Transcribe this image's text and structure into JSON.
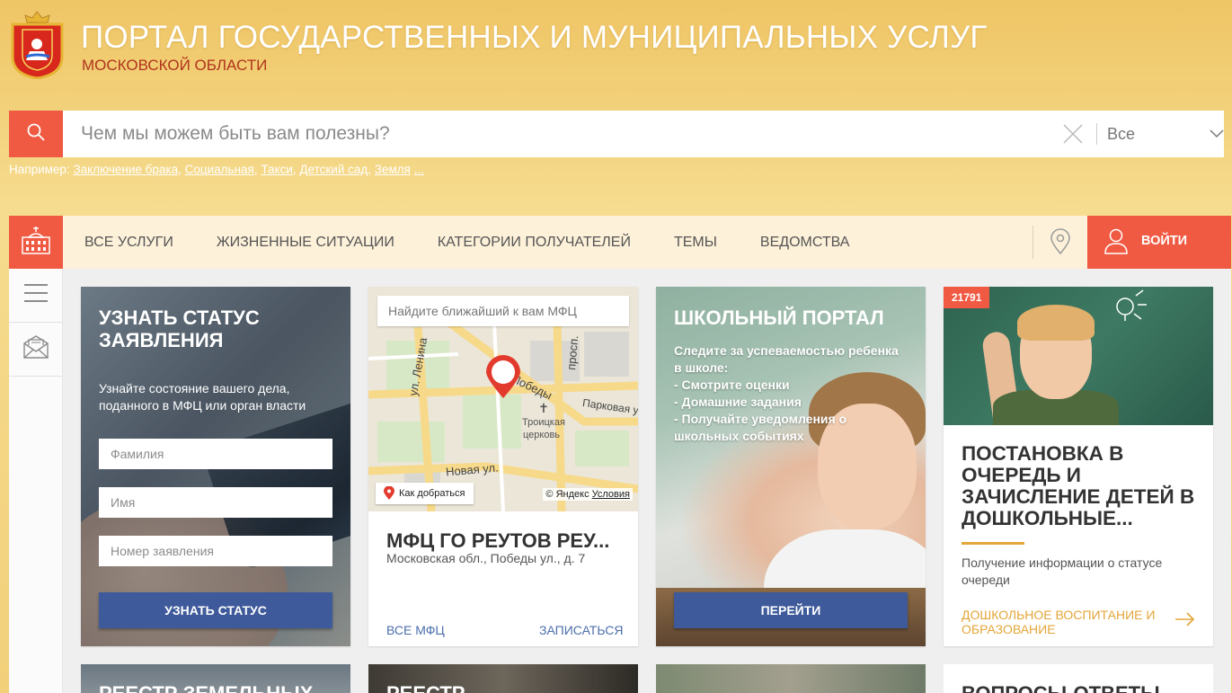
{
  "header": {
    "title": "ПОРТАЛ ГОСУДАРСТВЕННЫХ И МУНИЦИПАЛЬНЫХ УСЛУГ",
    "subtitle": "МОСКОВСКОЙ ОБЛАСТИ"
  },
  "search": {
    "placeholder": "Чем мы можем быть вам полезны?",
    "scope": "Все",
    "examples_label": "Например:",
    "examples": [
      "Заключение брака",
      "Социальная",
      "Такси",
      "Детский сад",
      "Земля"
    ],
    "examples_more": "..."
  },
  "nav": {
    "items": [
      "ВСЕ УСЛУГИ",
      "ЖИЗНЕННЫЕ СИТУАЦИИ",
      "КАТЕГОРИИ ПОЛУЧАТЕЛЕЙ",
      "ТЕМЫ",
      "ВЕДОМСТВА"
    ],
    "login": "ВОЙТИ"
  },
  "cards": {
    "status": {
      "title": "УЗНАТЬ СТАТУС ЗАЯВЛЕНИЯ",
      "desc": "Узнайте состояние вашего дела, поданного в МФЦ или орган власти",
      "fields": [
        "Фамилия",
        "Имя",
        "Номер заявления"
      ],
      "button": "УЗНАТЬ СТАТУС"
    },
    "mfc": {
      "search_placeholder": "Найдите ближайший к вам МФЦ",
      "route": "Как добраться",
      "copyright": "© Яндекс",
      "terms": "Условия",
      "streets": [
        "ул. Ленина",
        "просп.",
        "Победы",
        "Парковая ул.",
        "Новая ул.",
        "Троицкая",
        "церковь"
      ],
      "name": "МФЦ ГО РЕУТОВ РЕУ...",
      "address": "Московская обл., Победы ул., д. 7",
      "all": "ВСЕ МФЦ",
      "signup": "ЗАПИСАТЬСЯ"
    },
    "school": {
      "title": "ШКОЛЬНЫЙ ПОРТАЛ",
      "desc": "Следите за успеваемостью ребенка в школе:\n- Смотрите оценки\n- Домашние задания\n- Получайте уведомления о школьных событиях",
      "button": "ПЕРЕЙТИ"
    },
    "queue": {
      "badge": "21791",
      "title": "ПОСТАНОВКА В ОЧЕРЕДЬ И ЗАЧИСЛЕНИЕ ДЕТЕЙ В ДОШКОЛЬНЫЕ...",
      "desc": "Получение информации о статусе очереди",
      "link": "ДОШКОЛЬНОЕ ВОСПИТАНИЕ И ОБРАЗОВАНИЕ"
    }
  },
  "bottom": [
    "РЕЕСТР ЗЕМЕЛЬНЫХ",
    "РЕЕСТР",
    "",
    "ВОПРОСЫ-ОТВЕТЫ"
  ],
  "colors": {
    "accent": "#f05a43",
    "button_blue": "#3e5a9a",
    "link_blue": "#4c6fac",
    "gold": "#e4a63a",
    "subtitle_red": "#b0341d"
  },
  "icons": [
    "coat-of-arms-icon",
    "search-icon",
    "close-icon",
    "chevron-down-icon",
    "building-icon",
    "location-pin-icon",
    "user-icon",
    "menu-icon",
    "mail-icon",
    "arrow-right-icon",
    "map-pin-icon"
  ]
}
